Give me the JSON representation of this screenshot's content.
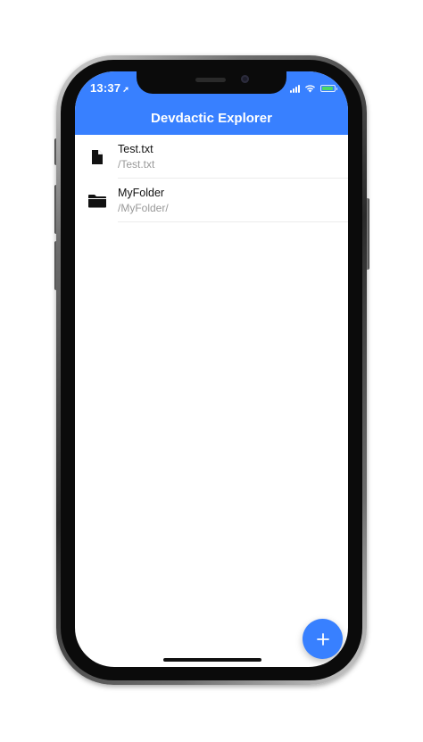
{
  "status_bar": {
    "time": "13:37",
    "location_arrow": "➚",
    "signal_icon": "cellular-signal-icon",
    "wifi_icon": "wifi-icon",
    "battery_icon": "battery-charging-icon",
    "battery_level": 0.9
  },
  "header": {
    "title": "Devdactic Explorer",
    "background_color": "#3880ff"
  },
  "files": [
    {
      "name": "Test.txt",
      "path": "/Test.txt",
      "icon": "document-icon",
      "kind": "file"
    },
    {
      "name": "MyFolder",
      "path": "/MyFolder/",
      "icon": "folder-icon",
      "kind": "folder"
    }
  ],
  "fab": {
    "icon": "plus-icon",
    "color": "#3880ff"
  }
}
